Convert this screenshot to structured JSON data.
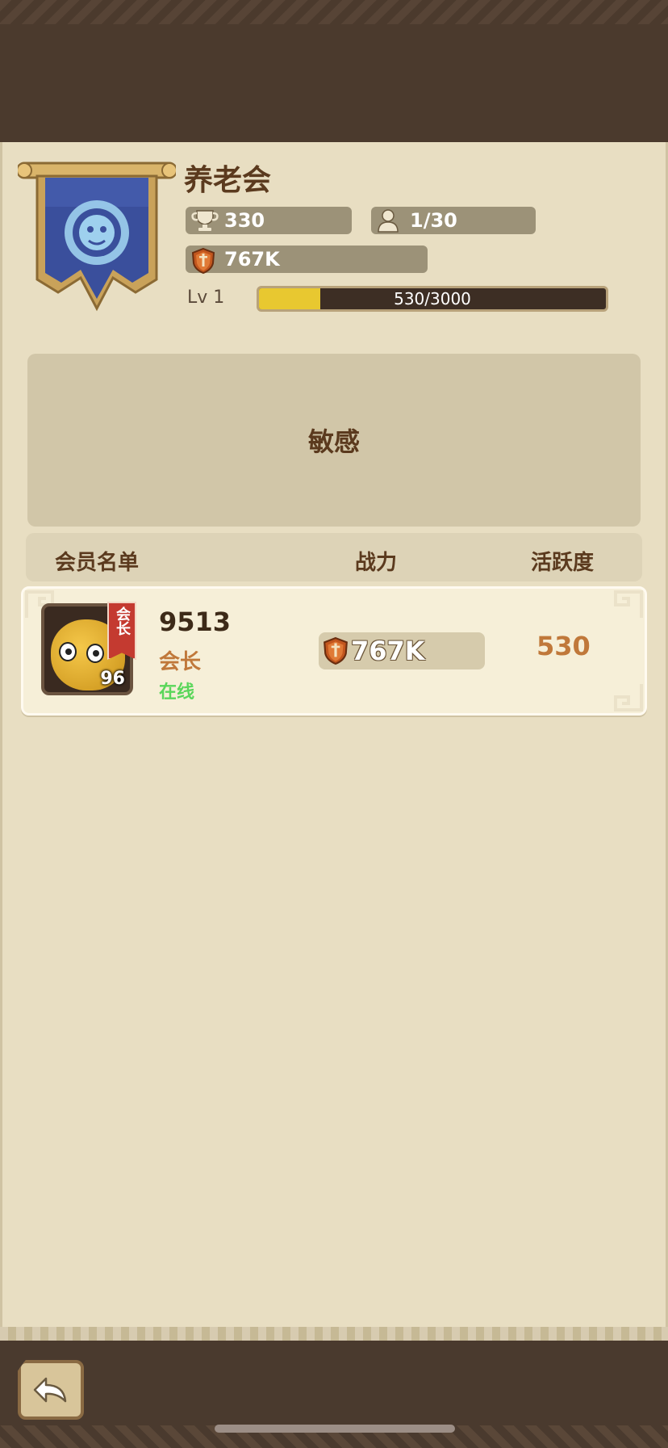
{
  "guild": {
    "name": "养老会",
    "trophies": "330",
    "members": "1/30",
    "power": "767K",
    "level_label": "Lv  1",
    "xp_text": "530/3000",
    "xp_fraction": 0.1767
  },
  "announcement": {
    "text": "敏感"
  },
  "table": {
    "headers": {
      "members": "会员名单",
      "power": "战力",
      "activity": "活跃度"
    },
    "rows": [
      {
        "name": "9513",
        "role": "会长",
        "tag": "会长",
        "status": "在线",
        "level": "96",
        "power": "767K",
        "activity": "530"
      }
    ]
  },
  "colors": {
    "background": "#e8dec2",
    "bar": "#4a3a2e",
    "accent_orange": "#c0783a",
    "online_green": "#5ad65a",
    "banner_blue": "#3a4f9c"
  },
  "icons": {
    "trophy": "trophy-icon",
    "members": "person-icon",
    "power": "shield-sword-icon",
    "back": "back-arrow-icon"
  }
}
